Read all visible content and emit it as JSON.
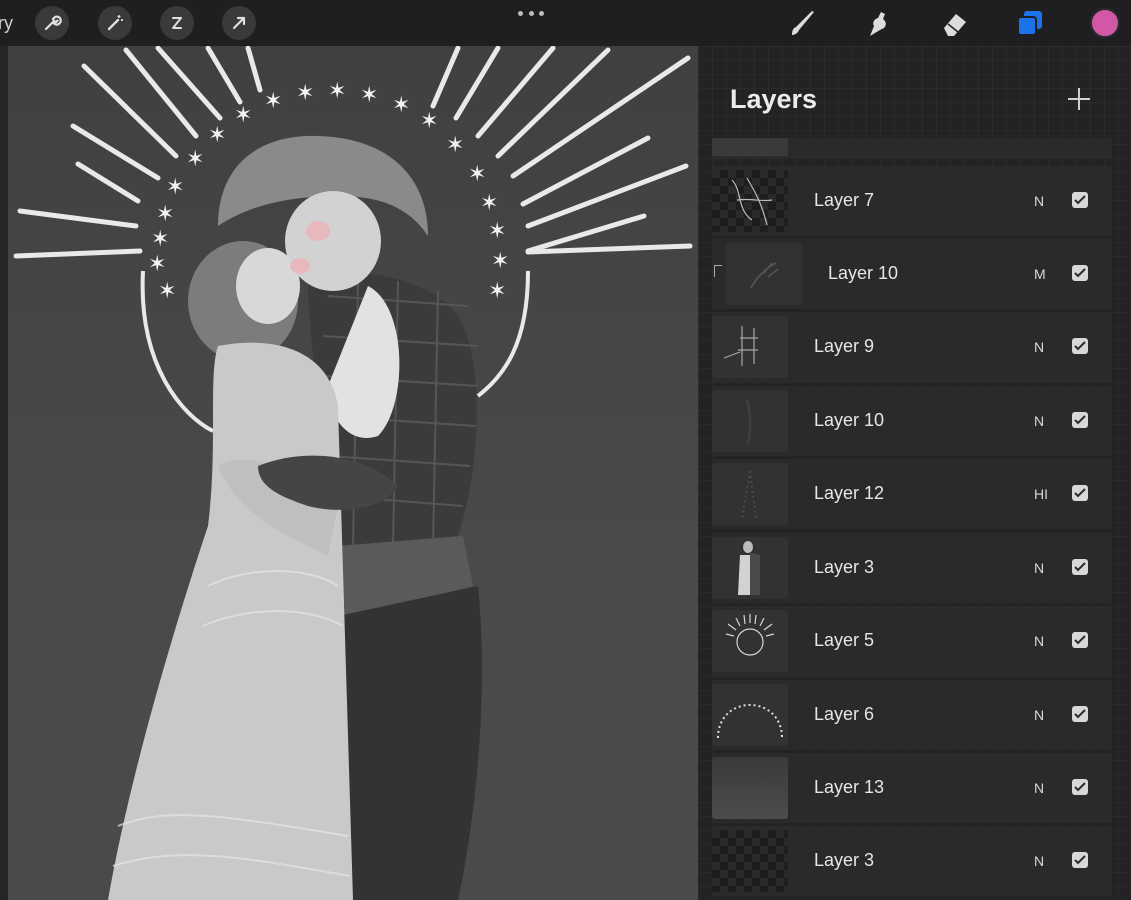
{
  "toolbar": {
    "gallery_fragment": "ry",
    "left_tools": [
      {
        "name": "wrench-icon"
      },
      {
        "name": "magic-wand-icon"
      },
      {
        "name": "selection-icon"
      },
      {
        "name": "transform-arrow-icon"
      }
    ],
    "right_tools": [
      {
        "name": "brush-icon"
      },
      {
        "name": "smudge-icon"
      },
      {
        "name": "eraser-icon"
      },
      {
        "name": "layers-icon"
      }
    ],
    "active_color": "#d257a7",
    "layers_icon_color": "#1a73e8"
  },
  "panel": {
    "title": "Layers",
    "layers": [
      {
        "name": "Layer 7",
        "blend": "N",
        "visible": true,
        "clipped": false,
        "thumb": "checker-sketch"
      },
      {
        "name": "Layer 10",
        "blend": "M",
        "visible": true,
        "clipped": true,
        "thumb": "hand"
      },
      {
        "name": "Layer 9",
        "blend": "N",
        "visible": true,
        "clipped": false,
        "thumb": "grid-sketch"
      },
      {
        "name": "Layer 10",
        "blend": "N",
        "visible": true,
        "clipped": false,
        "thumb": "dark"
      },
      {
        "name": "Layer 12",
        "blend": "HI",
        "visible": true,
        "clipped": false,
        "thumb": "sparkle"
      },
      {
        "name": "Layer 3",
        "blend": "N",
        "visible": true,
        "clipped": false,
        "thumb": "couple"
      },
      {
        "name": "Layer 5",
        "blend": "N",
        "visible": true,
        "clipped": false,
        "thumb": "halo"
      },
      {
        "name": "Layer 6",
        "blend": "N",
        "visible": true,
        "clipped": false,
        "thumb": "star-arc"
      },
      {
        "name": "Layer 13",
        "blend": "N",
        "visible": true,
        "clipped": false,
        "thumb": "gradient"
      },
      {
        "name": "Layer 3",
        "blend": "N",
        "visible": true,
        "clipped": false,
        "thumb": "checker"
      }
    ]
  }
}
